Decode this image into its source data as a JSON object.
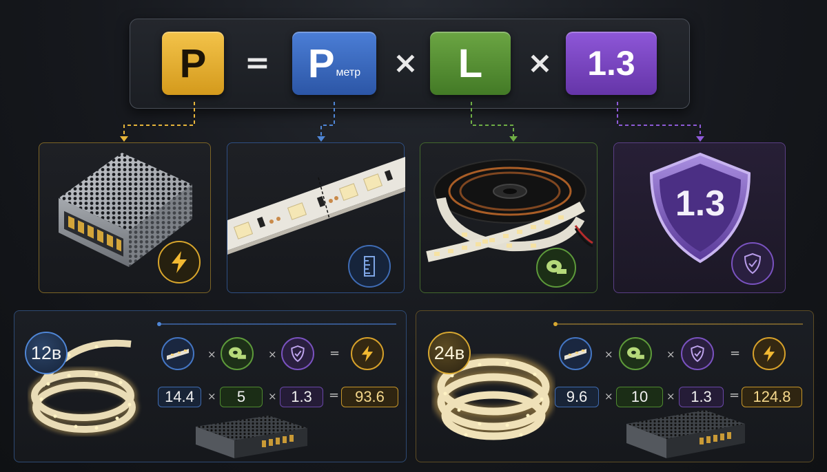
{
  "formula": {
    "result": "P",
    "per_meter": "P",
    "per_meter_sub": "метр",
    "length": "L",
    "coefficient": "1.3",
    "eq_sign": "=",
    "times_sign": "×"
  },
  "cards": {
    "coef_shield_text": "1.3"
  },
  "examples": [
    {
      "voltage": "12в",
      "values": [
        "14.4",
        "5",
        "1.3",
        "93.6"
      ],
      "accent": "#4f86d6"
    },
    {
      "voltage": "24в",
      "values": [
        "9.6",
        "10",
        "1.3",
        "124.8"
      ],
      "accent": "#d8a831"
    }
  ],
  "ops": {
    "times": "×",
    "equals": "="
  },
  "colors": {
    "power": "#e7b53a",
    "per_meter": "#3f73cc",
    "length": "#5d9a3a",
    "coefficient": "#7e4bc8"
  },
  "icons": [
    "lightning-icon",
    "ruler-icon",
    "tape-measure-icon",
    "shield-check-icon"
  ]
}
